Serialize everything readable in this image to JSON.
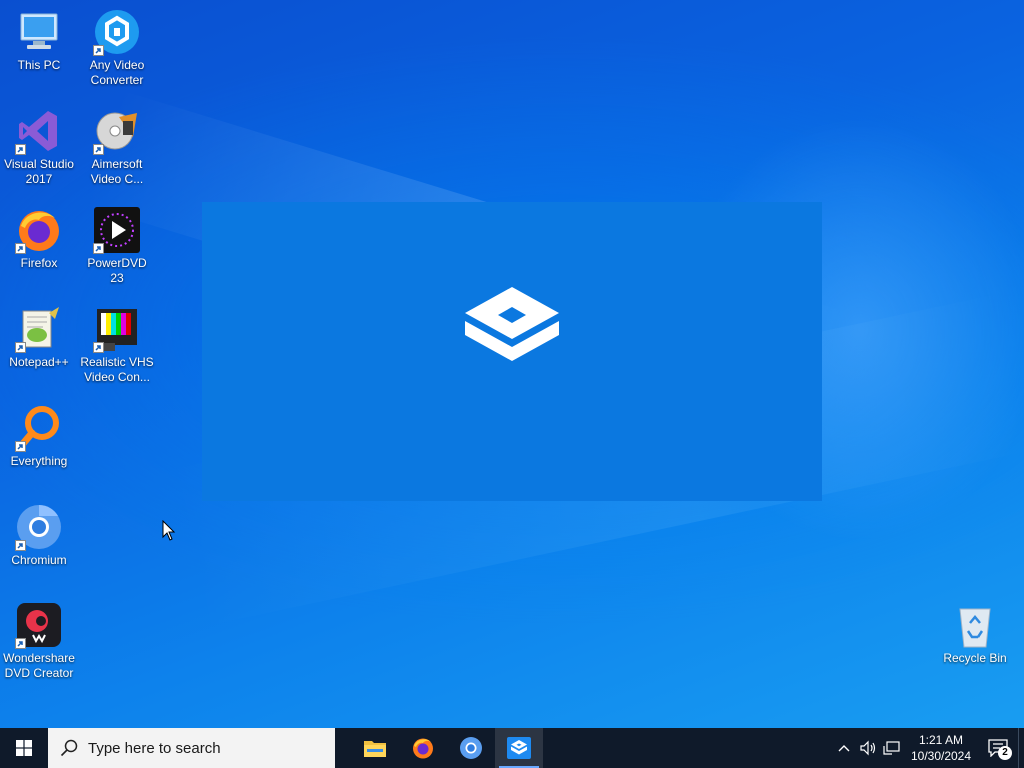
{
  "desktop": {
    "icons": [
      {
        "label": "This PC",
        "icon": "computer-icon"
      },
      {
        "label": "Any Video Converter",
        "icon": "any-video-converter-icon"
      },
      {
        "label": "Visual Studio 2017",
        "icon": "visual-studio-icon"
      },
      {
        "label": "Aimersoft Video C...",
        "icon": "aimersoft-icon"
      },
      {
        "label": "Firefox",
        "icon": "firefox-icon"
      },
      {
        "label": "PowerDVD 23",
        "icon": "powerdvd-icon"
      },
      {
        "label": "Notepad++",
        "icon": "notepadpp-icon"
      },
      {
        "label": "Realistic VHS Video Con...",
        "icon": "vhs-icon"
      },
      {
        "label": "Everything",
        "icon": "everything-search-icon"
      },
      {
        "label": "Chromium",
        "icon": "chromium-icon"
      },
      {
        "label": "Wondershare DVD Creator",
        "icon": "wondershare-icon"
      },
      {
        "label": "Recycle Bin",
        "icon": "recycle-bin-icon"
      }
    ]
  },
  "splash": {
    "icon": "sandbox-box-icon",
    "color": "#0b78e0"
  },
  "taskbar": {
    "search_placeholder": "Type here to search",
    "apps": [
      {
        "name": "File Explorer",
        "icon": "folder-icon"
      },
      {
        "name": "Firefox",
        "icon": "firefox-icon"
      },
      {
        "name": "Chromium",
        "icon": "chromium-icon"
      },
      {
        "name": "Windows Sandbox",
        "icon": "sandbox-box-icon",
        "active": true
      }
    ],
    "clock": {
      "time": "1:21 AM",
      "date": "10/30/2024"
    },
    "notification_count": "2"
  },
  "colors": {
    "taskbar": "#0f1a2a",
    "accent": "#0b78e0",
    "search_bg": "#f3f3f3"
  }
}
